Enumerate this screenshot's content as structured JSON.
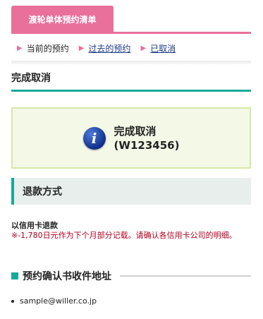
{
  "header": {
    "tab_title": "渡轮单体预约清单"
  },
  "subnav": [
    {
      "label": "当前的预约",
      "active": true
    },
    {
      "label": "过去的预约",
      "active": false
    },
    {
      "label": "已取消",
      "active": false
    }
  ],
  "section": {
    "title": "完成取消"
  },
  "notice": {
    "icon": "info-icon",
    "line1": "完成取消",
    "line2": "(W123456)"
  },
  "refund": {
    "heading": "退款方式",
    "method": "以信用卡退款",
    "note": "※-1,780日元作为下个月部分记载。请确认各信用卡公司的明细。"
  },
  "address": {
    "heading": "预约确认书收件地址",
    "email": "sample@willer.co.jp"
  },
  "colors": {
    "pink": "#e8709b",
    "teal": "#17a99a",
    "red": "#b00020",
    "link": "#1e3a8a"
  }
}
